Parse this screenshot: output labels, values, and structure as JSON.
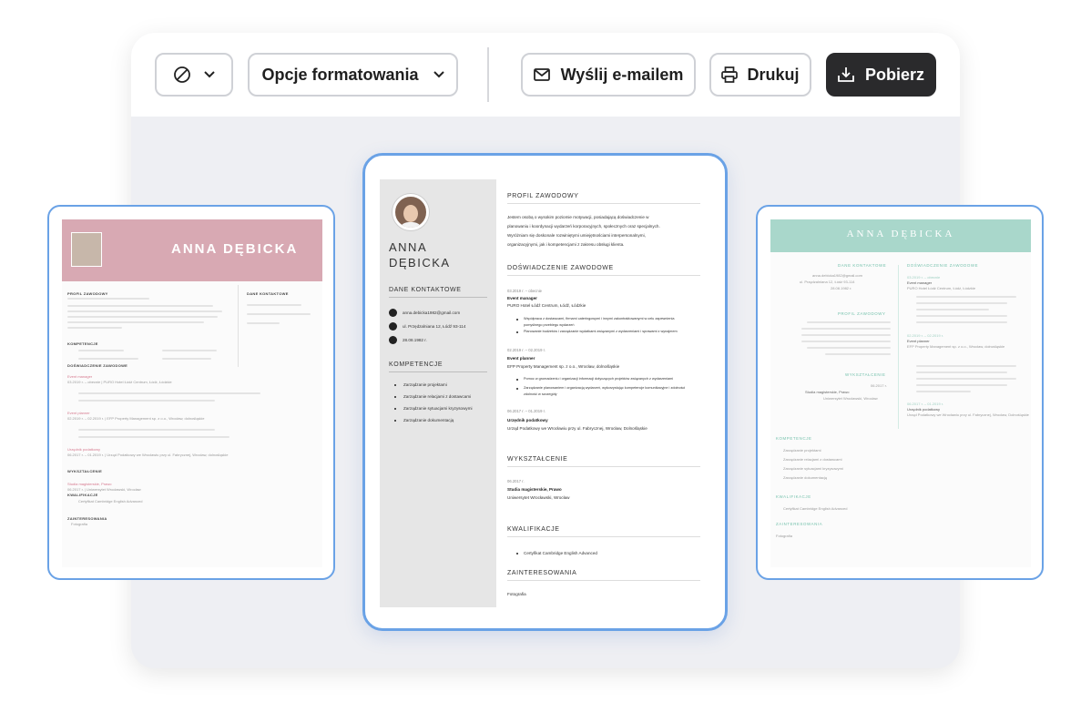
{
  "toolbar": {
    "visibility_label": "",
    "format_label": "Opcje formatowania",
    "email_label": "Wyślij e-mailem",
    "print_label": "Drukuj",
    "download_label": "Pobierz"
  },
  "colors": {
    "card_border": "#6aa2e6",
    "download_bg": "#2a2a2c",
    "pink_header": "#d8a9b3",
    "mint_header": "#a9d7cb"
  },
  "icons": {
    "visibility": "slash-circle-icon",
    "chevron": "chevron-down-icon",
    "email": "envelope-icon",
    "print": "printer-icon",
    "download": "download-icon"
  },
  "left_resume": {
    "name": "ANNA DĘBICKA",
    "profile_heading": "PROFIL ZAWODOWY",
    "contact_heading": "DANE KONTAKTOWE",
    "competences_heading": "KOMPETENCJE",
    "experience_heading": "DOŚWIADCZENIE ZAWODOWE",
    "job1_title": "Event manager",
    "job1_meta": "03.2019 r. – obecnie  |  PURO Hotel Łódź Centrum, Łódź, Łódzkie",
    "job2_title": "Event planner",
    "job2_meta": "02.2019 r. – 02.2019 r.  |  EFP Property Management sp. z o.o., Wrocław, dolnośląskie",
    "job3_title": "Urzędnik podatkowy",
    "job3_meta": "06.2017 r. – 01.2019 r.  |  Urząd Podatkowy we Wrocławiu przy ul. Fabrycznej, Wrocław, dolnośląskie",
    "education_heading": "WYKSZTAŁCENIE",
    "education_title": "Studia magisterskie, Prawo",
    "education_meta": "06.2017 r.  |  Uniwersytet Wrocławski, Wrocław",
    "qualifications_heading": "KWALIFIKACJE",
    "qualifications_item": "Certyfikat Cambridge English Advanced",
    "interests_heading": "ZAINTERESOWANIA",
    "interests_item": "Fotografia"
  },
  "center_resume": {
    "name_first": "ANNA",
    "name_last": "DĘBICKA",
    "contact_heading": "DANE KONTAKTOWE",
    "email": "anna.debicka1982@gmail.com",
    "address": "ul. Przędzalniana 12, Łódź 93-114",
    "dob": "28.08.1982 r.",
    "competences_heading": "KOMPETENCJE",
    "competences": [
      "Zarządzanie projektami",
      "Zarządzanie relacjami z dostawcami",
      "Zarządzanie sytuacjami kryzysowymi",
      "Zarządzanie dokumentacją"
    ],
    "profile_heading": "PROFIL ZAWODOWY",
    "profile_lines": [
      "Jestem osobą o wysokim poziomie motywacji, posiadającą doświadczenie w",
      "planowaniu i koordynacji wydarzeń korporacyjnych, społecznych oraz specjalnych.",
      "Wyróżniam się doskonale rozwiniętymi umiejętnościami interpersonalnymi,",
      "organizacyjnymi, jak i kompetencjami z zakresu obsługi klienta."
    ],
    "experience_heading": "DOŚWIADCZENIE ZAWODOWE",
    "job1_dates": "03.2019 r. – obecnie",
    "job1_title": "Event manager",
    "job1_company": "PURO Hotel Łódź Centrum, Łódź, Łódzkie",
    "job1_bullets": [
      "Współpraca z dostawcami, firmami cateringowymi i innymi zakontraktowanymi w celu zapewnienia",
      "pomyślnego przebiegu wydarzeń",
      "Planowanie budżetów i zarządzanie wydatkami związanymi z wydarzeniami i sprawami z wynajmem"
    ],
    "job2_dates": "02.2019 r. – 02.2019 r.",
    "job2_title": "Event planner",
    "job2_company": "EFP Property Management sp. z o.o., Wrocław, dolnośląskie",
    "job2_bullets": [
      "Pomoc w gromadzeniu i organizacji informacji dotyczących projektów związanych z wydarzeniami",
      "Zarządzanie planowaniem i organizacją wydarzeń, wykorzystując kompetencje komunikacyjne i zdolności",
      "zdolność w szczegóły"
    ],
    "job3_dates": "06.2017 r. – 01.2019 r.",
    "job3_title": "Urzędnik podatkowy",
    "job3_company": "Urząd Podatkowy we Wrocławiu przy ul. Fabrycznej, Wrocław, Dolnośląskie",
    "education_heading": "WYKSZTAŁCENIE",
    "education_date": "06.2017 r.",
    "education_title": "Studia magisterskie, Prawo",
    "education_school": "Uniwersytet Wrocławski, Wrocław",
    "qualifications_heading": "KWALIFIKACJE",
    "qualifications_item": "Certyfikat Cambridge English Advanced",
    "interests_heading": "ZAINTERESOWANIA",
    "interests_item": "Fotografia"
  },
  "right_resume": {
    "name": "ANNA DĘBICKA",
    "contact_heading": "DANE KONTAKTOWE",
    "email": "anna.debicka1982@gmail.com",
    "address": "ul. Przędzalniana 12, Łódź 93-114",
    "dob": "28.08.1982 r.",
    "profile_heading": "PROFIL ZAWODOWY",
    "education_heading": "WYKSZTAŁCENIE",
    "education_date": "06.2017 r.",
    "education_title": "Studia magisterskie, Prawo",
    "education_school": "Uniwersytet Wrocławski, Wrocław",
    "experience_heading": "DOŚWIADCZENIE ZAWODOWE",
    "job1_dates": "03.2019 r. – obecnie",
    "job1_title": "Event manager",
    "job1_company": "PURO Hotel Łódź Centrum, Łódź, Łódzkie",
    "job2_dates": "02.2019 r. – 02.2019 r.",
    "job2_title": "Event planner",
    "job2_company": "EFP Property Management sp. z o.o., Wrocław, dolnośląskie",
    "job3_dates": "06.2017 r. – 01.2019 r.",
    "job3_title": "Urzędnik podatkowy",
    "job3_company": "Urząd Podatkowy we Wrocławiu przy ul. Fabrycznej, Wrocław, Dolnośląskie",
    "competences_heading": "KOMPETENCJE",
    "competences": [
      "Zarządzanie projektami",
      "Zarządzanie relacjami z dostawcami",
      "Zarządzanie sytuacjami kryzysowymi",
      "Zarządzanie dokumentacją"
    ],
    "qualifications_heading": "KWALIFIKACJE",
    "qualifications_item": "Certyfikat Cambridge English Advanced",
    "interests_heading": "ZAINTERESOWANIA",
    "interests_item": "Fotografia"
  }
}
